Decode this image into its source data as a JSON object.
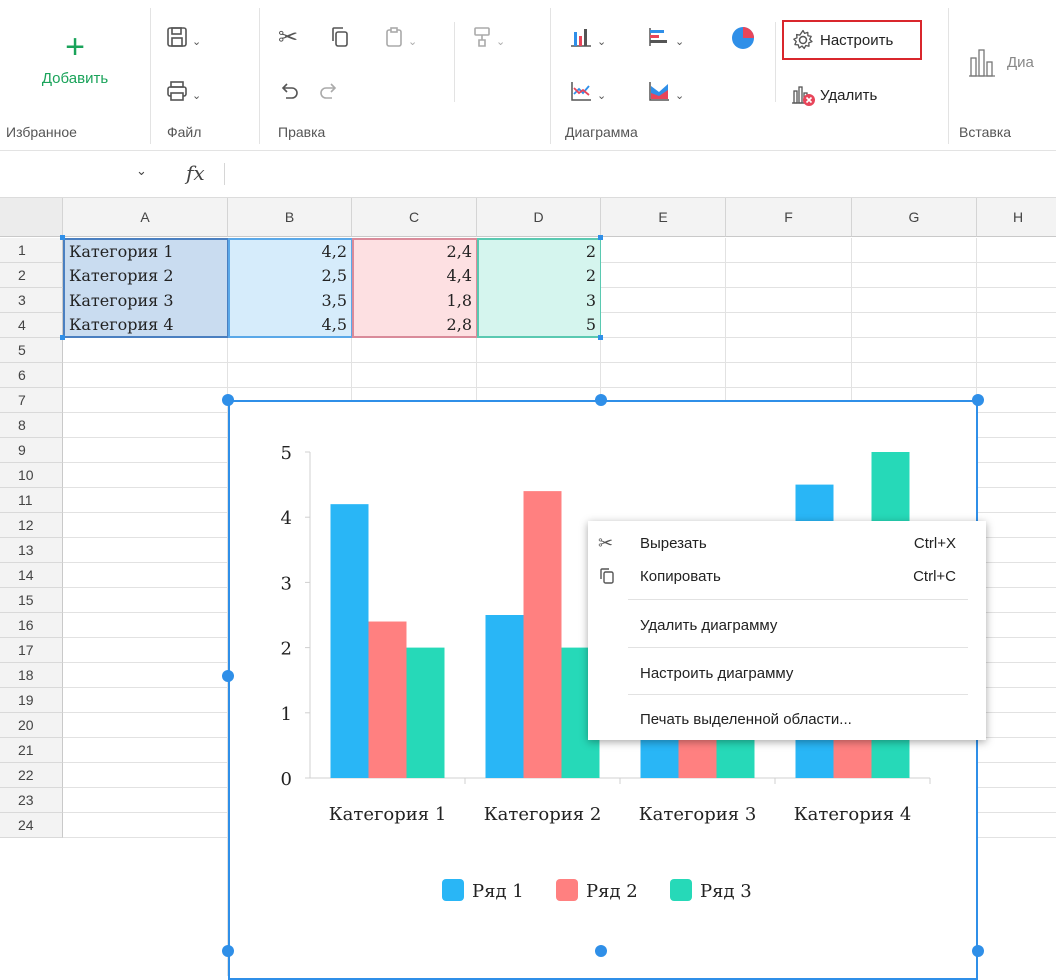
{
  "ribbon": {
    "favorites": {
      "add_label": "Добавить",
      "group_label": "Избранное"
    },
    "file": {
      "group_label": "Файл"
    },
    "edit": {
      "group_label": "Правка"
    },
    "chart": {
      "group_label": "Диаграмма",
      "configure_label": "Настроить",
      "delete_label": "Удалить"
    },
    "insert": {
      "group_label": "Вставка",
      "truncated_label": "Диа"
    }
  },
  "formula_bar": {
    "fx_label": "fx",
    "value": ""
  },
  "columns": [
    "A",
    "B",
    "C",
    "D",
    "E",
    "F",
    "G",
    "H"
  ],
  "rows": [
    "1",
    "2",
    "3",
    "4",
    "5",
    "6",
    "7",
    "8",
    "9",
    "10",
    "11",
    "12",
    "13",
    "14",
    "15",
    "16",
    "17",
    "18",
    "19",
    "20",
    "21",
    "22",
    "23",
    "24"
  ],
  "cells": [
    [
      "Категория 1",
      "4,2",
      "2,4",
      "2"
    ],
    [
      "Категория 2",
      "2,5",
      "4,4",
      "2"
    ],
    [
      "Категория 3",
      "3,5",
      "1,8",
      "3"
    ],
    [
      "Категория 4",
      "4,5",
      "2,8",
      "5"
    ]
  ],
  "colors": {
    "series1": "#29b6f6",
    "series2": "#ff8080",
    "series3": "#26d9b8",
    "selection": "#2f8fe8",
    "highlight_box": "#d9262c"
  },
  "chart_data": {
    "type": "bar",
    "categories": [
      "Категория 1",
      "Категория 2",
      "Категория 3",
      "Категория 4"
    ],
    "series": [
      {
        "name": "Ряд 1",
        "values": [
          4.2,
          2.5,
          3.5,
          4.5
        ]
      },
      {
        "name": "Ряд 2",
        "values": [
          2.4,
          4.4,
          1.8,
          2.8
        ]
      },
      {
        "name": "Ряд 3",
        "values": [
          2,
          2,
          3,
          5
        ]
      }
    ],
    "yticks": [
      "0",
      "1",
      "2",
      "3",
      "4",
      "5"
    ],
    "ylim": [
      0,
      5
    ],
    "legend": "bottom",
    "grid": false
  },
  "context_menu": {
    "cut": {
      "label": "Вырезать",
      "shortcut": "Ctrl+X"
    },
    "copy": {
      "label": "Копировать",
      "shortcut": "Ctrl+C"
    },
    "delete_chart": "Удалить диаграмму",
    "configure_chart": "Настроить диаграмму",
    "print_selection": "Печать выделенной области..."
  }
}
